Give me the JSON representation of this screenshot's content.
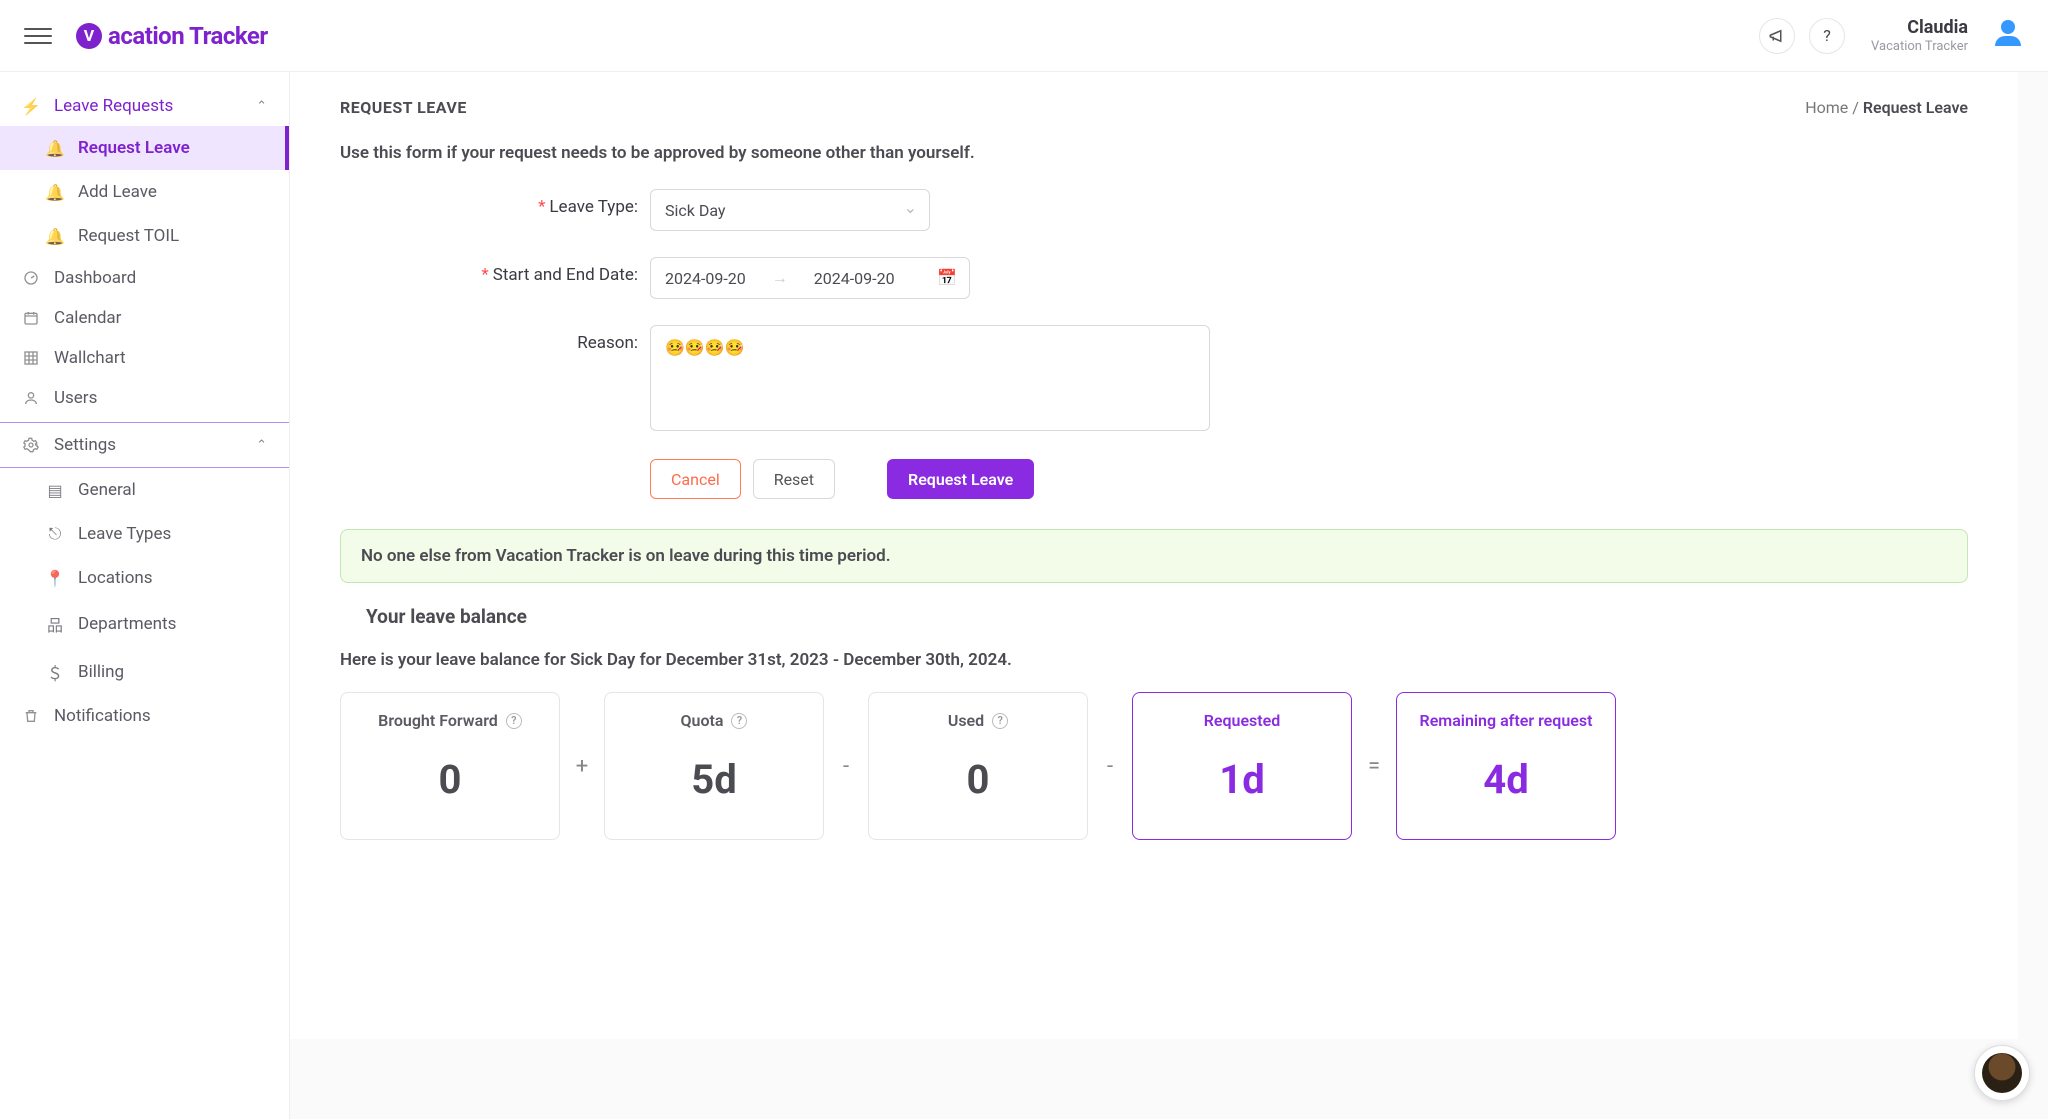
{
  "brand": {
    "name": "acation Tracker",
    "logoLetter": "V"
  },
  "header": {
    "user_name": "Claudia",
    "user_sub": "Vacation Tracker"
  },
  "sidebar": {
    "leave_requests_label": "Leave Requests",
    "leave_items": {
      "request_leave": "Request Leave",
      "add_leave": "Add Leave",
      "request_toil": "Request TOIL"
    },
    "dashboard": "Dashboard",
    "calendar": "Calendar",
    "wallchart": "Wallchart",
    "users": "Users",
    "settings_label": "Settings",
    "settings_items": {
      "general": "General",
      "leave_types": "Leave Types",
      "locations": "Locations",
      "departments": "Departments",
      "billing": "Billing"
    },
    "notifications": "Notifications"
  },
  "breadcrumb": {
    "home": "Home",
    "sep": " / ",
    "current": "Request Leave"
  },
  "page": {
    "title": "REQUEST LEAVE",
    "subtitle": "Use this form if your request needs to be approved by someone other than yourself."
  },
  "form": {
    "leave_type_label": "Leave Type:",
    "leave_type_value": "Sick Day",
    "date_label": "Start and End Date:",
    "date_start": "2024-09-20",
    "date_end": "2024-09-20",
    "reason_label": "Reason:",
    "reason_value": "🤒🤒🤒🤒",
    "cancel": "Cancel",
    "reset": "Reset",
    "submit": "Request Leave"
  },
  "alert": "No one else from Vacation Tracker is on leave during this time period.",
  "balance": {
    "heading": "Your leave balance",
    "desc": "Here is your leave balance for Sick Day for December 31st, 2023 - December 30th, 2024.",
    "cards": {
      "brought_forward_label": "Brought Forward",
      "brought_forward_value": "0",
      "quota_label": "Quota",
      "quota_value": "5d",
      "used_label": "Used",
      "used_value": "0",
      "requested_label": "Requested",
      "requested_value": "1d",
      "remaining_label": "Remaining after request",
      "remaining_value": "4d"
    },
    "ops": {
      "plus": "+",
      "minus": "-",
      "equals": "="
    }
  }
}
